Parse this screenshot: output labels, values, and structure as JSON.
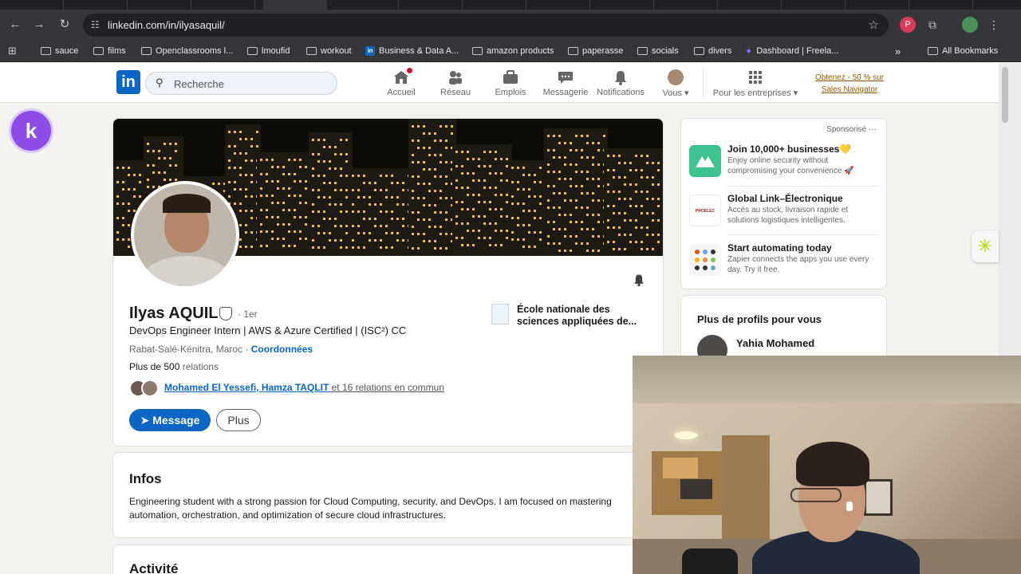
{
  "browser": {
    "url": "linkedin.com/in/ilyasaquil/",
    "bookmarks": [
      {
        "label": "sauce",
        "icon": "folder-icon"
      },
      {
        "label": "films",
        "icon": "folder-icon"
      },
      {
        "label": "Openclassrooms l...",
        "icon": "folder-icon"
      },
      {
        "label": "lmoufid",
        "icon": "folder-icon"
      },
      {
        "label": "workout",
        "icon": "folder-icon"
      },
      {
        "label": "Business & Data A...",
        "icon": "linkedin-icon"
      },
      {
        "label": "amazon products",
        "icon": "folder-icon"
      },
      {
        "label": "paperasse",
        "icon": "folder-icon"
      },
      {
        "label": "socials",
        "icon": "folder-icon"
      },
      {
        "label": "divers",
        "icon": "folder-icon"
      },
      {
        "label": "Dashboard | Freela...",
        "icon": "star-icon"
      }
    ],
    "more_bookmarks": "»",
    "all_bookmarks": "All Bookmarks"
  },
  "linkedin_nav": {
    "search_placeholder": "Recherche",
    "items": [
      {
        "label": "Accueil",
        "icon": "home-icon"
      },
      {
        "label": "Réseau",
        "icon": "network-icon"
      },
      {
        "label": "Emplois",
        "icon": "briefcase-icon"
      },
      {
        "label": "Messagerie",
        "icon": "message-icon"
      },
      {
        "label": "Notifications",
        "icon": "bell-icon"
      },
      {
        "label": "Vous ▾",
        "icon": "avatar"
      },
      {
        "label": "Pour les entreprises ▾",
        "icon": "grid-icon"
      }
    ],
    "promo_line1": "Obtenez - 50 % sur",
    "promo_line2": "Sales Navigator"
  },
  "profile": {
    "name": "Ilyas AQUIL",
    "degree": "· 1er",
    "headline": "DevOps Engineer Intern | AWS & Azure Certified | (ISC²) CC",
    "location": "Rabat-Salé-Kénitra, Maroc ·",
    "contact_link": "Coordonnées",
    "relations_prefix": "Plus de 500",
    "relations_suffix": " relations",
    "mutual_names": "Mohamed El Yessefi, Hamza TAQLIT",
    "mutual_suffix": " et 16 relations en commun",
    "message_button": "Message",
    "more_button": "Plus",
    "school_line1": "École nationale des",
    "school_line2": "sciences appliquées de..."
  },
  "infos": {
    "title": "Infos",
    "text": "Engineering student with a strong passion for Cloud Computing, security, and DevOps. I am focused on mastering automation, orchestration, and optimization of secure cloud infrastructures."
  },
  "activity": {
    "title": "Activité"
  },
  "sponsored": {
    "label": "Sponsorisé ···",
    "ads": [
      {
        "title": "Join 10,000+ businesses💛",
        "desc": "Enjoy online security without compromising your convenience 🚀",
        "color": "#3ec28f"
      },
      {
        "title": "Global Link–Électronique",
        "desc": "Accès au stock, livraison rapide et solutions logistiques intelligentes.",
        "color": "#ffffff"
      },
      {
        "title": "Start automating today",
        "desc": "Zapier connects the apps you use every day. Try it free.",
        "color": "#f2f2f2"
      }
    ]
  },
  "more_profiles": {
    "title": "Plus de profils pour vous",
    "first_name": "Yahia Mohamed"
  }
}
